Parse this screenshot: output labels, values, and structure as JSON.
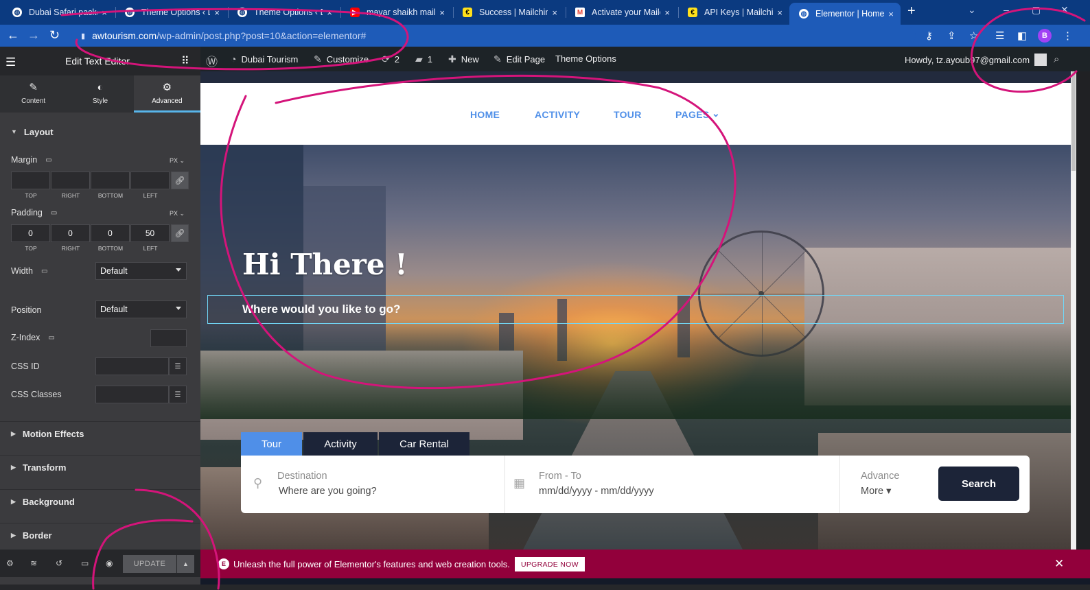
{
  "browser": {
    "tabs": [
      {
        "title": "Dubai Safari packa",
        "favicon": "globe-icon",
        "active": false
      },
      {
        "title": "Theme Options ‹ D",
        "favicon": "globe-icon",
        "active": false
      },
      {
        "title": "Theme Options ‹ D",
        "favicon": "globe-icon",
        "active": false
      },
      {
        "title": "mayar shaikh mail",
        "favicon": "youtube-icon",
        "active": false
      },
      {
        "title": "Success | Mailchim",
        "favicon": "mailchimp-icon",
        "active": false
      },
      {
        "title": "Activate your Mailc",
        "favicon": "gmail-icon",
        "active": false
      },
      {
        "title": "API Keys | Mailchim",
        "favicon": "mailchimp-icon",
        "active": false
      },
      {
        "title": "Elementor | Home",
        "favicon": "globe-icon",
        "active": true
      }
    ],
    "tab_close": "×",
    "new_tab": "+",
    "url_host": "awtourism.com",
    "url_path": "/wp-admin/post.php?post=10&action=elementor#",
    "profile_initial": "B",
    "colors": {
      "tabstrip": "#0b3a80",
      "toolbar": "#1e5bb8",
      "profile": "#a142f4"
    }
  },
  "elementor": {
    "panel_title": "Edit Text Editor",
    "tabs": [
      {
        "label": "Content",
        "icon": "pencil-icon",
        "active": false
      },
      {
        "label": "Style",
        "icon": "half-circle-icon",
        "active": false
      },
      {
        "label": "Advanced",
        "icon": "gear-icon",
        "active": true
      }
    ],
    "layout_section": "Layout",
    "margin": {
      "label": "Margin",
      "unit": "PX",
      "values": [
        "",
        "",
        "",
        ""
      ],
      "sides": [
        "TOP",
        "RIGHT",
        "BOTTOM",
        "LEFT"
      ]
    },
    "padding": {
      "label": "Padding",
      "unit": "PX",
      "values": [
        "0",
        "0",
        "0",
        "50"
      ],
      "sides": [
        "TOP",
        "RIGHT",
        "BOTTOM",
        "LEFT"
      ]
    },
    "width": {
      "label": "Width",
      "value": "Default"
    },
    "position": {
      "label": "Position",
      "value": "Default"
    },
    "z_index": {
      "label": "Z-Index",
      "value": ""
    },
    "css_id": {
      "label": "CSS ID",
      "value": ""
    },
    "css_classes": {
      "label": "CSS Classes",
      "value": ""
    },
    "sections": [
      "Motion Effects",
      "Transform",
      "Background",
      "Border"
    ],
    "update_label": "UPDATE",
    "accent": "#58b5ea"
  },
  "adminbar": {
    "site_name": "Dubai Tourism",
    "customize": "Customize",
    "updates_count": "2",
    "comments_count": "1",
    "new_label": "New",
    "edit_page": "Edit Page",
    "theme_options": "Theme Options",
    "howdy": "Howdy, tz.ayoub97@gmail.com"
  },
  "site": {
    "nav": [
      "HOME",
      "ACTIVITY",
      "TOUR",
      "PAGES"
    ],
    "nav_color": "#4f8fe8",
    "hero_title": "Hi There !",
    "hero_subtitle": "Where would you like to go?",
    "search_tabs": [
      {
        "label": "Tour",
        "active": true
      },
      {
        "label": "Activity",
        "active": false
      },
      {
        "label": "Car Rental",
        "active": false
      }
    ],
    "destination": {
      "label": "Destination",
      "placeholder": "Where are you going?",
      "icon": "map-pin-icon"
    },
    "dates": {
      "label": "From - To",
      "placeholder": "mm/dd/yyyy - mm/dd/yyyy",
      "icon": "calendar-icon"
    },
    "advance": {
      "label": "Advance",
      "more": "More"
    },
    "search_button": "Search",
    "dark": "#1c2438"
  },
  "promo": {
    "message": "Unleash the full power of Elementor's features and web creation tools.",
    "button": "UPGRADE NOW",
    "color": "#92003b"
  }
}
